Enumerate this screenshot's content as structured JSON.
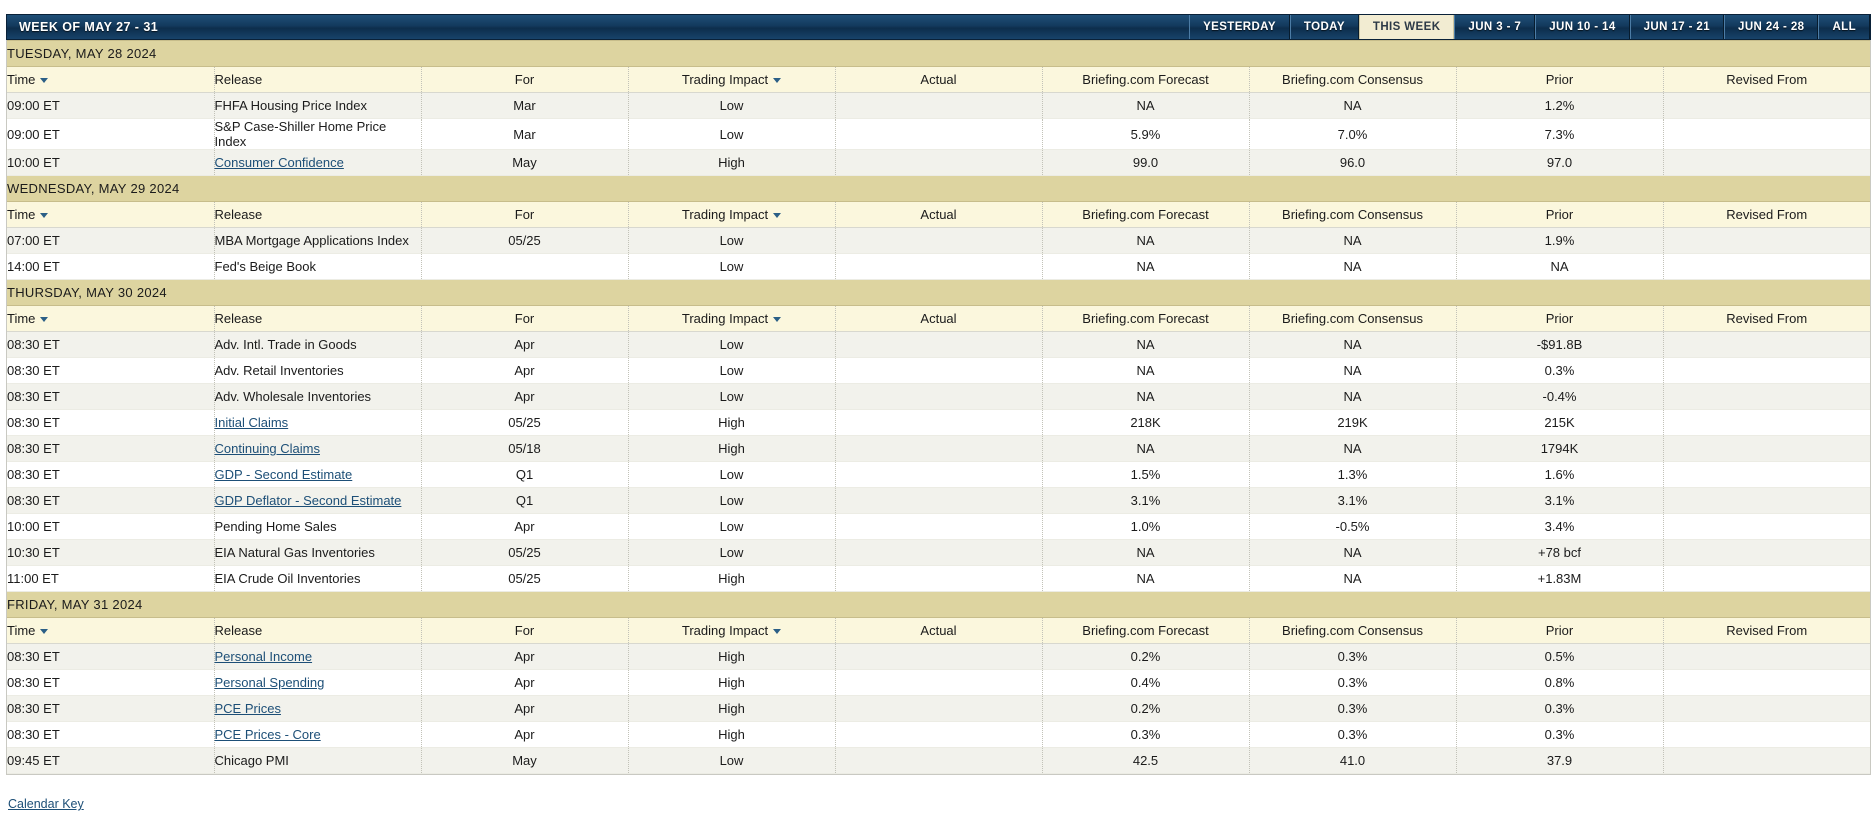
{
  "header": {
    "title": "WEEK OF MAY 27 - 31",
    "nav": [
      {
        "label": "YESTERDAY",
        "active": false
      },
      {
        "label": "TODAY",
        "active": false
      },
      {
        "label": "THIS WEEK",
        "active": true
      },
      {
        "label": "JUN 3 - 7",
        "active": false
      },
      {
        "label": "JUN 10 - 14",
        "active": false
      },
      {
        "label": "JUN 17 - 21",
        "active": false
      },
      {
        "label": "JUN 24 - 28",
        "active": false
      },
      {
        "label": "ALL",
        "active": false
      }
    ]
  },
  "columns": {
    "time": "Time",
    "release": "Release",
    "for": "For",
    "impact": "Trading Impact",
    "actual": "Actual",
    "forecast": "Briefing.com Forecast",
    "consensus": "Briefing.com Consensus",
    "prior": "Prior",
    "revised": "Revised From"
  },
  "icons": {
    "sort_caret": "caret-down-icon"
  },
  "days": [
    {
      "label": "TUESDAY, MAY 28 2024",
      "rows": [
        {
          "time": "09:00 ET",
          "release": "FHFA Housing Price Index",
          "link": false,
          "for": "Mar",
          "impact": "Low",
          "actual": "",
          "forecast": "NA",
          "consensus": "NA",
          "prior": "1.2%",
          "revised": ""
        },
        {
          "time": "09:00 ET",
          "release": "S&P Case-Shiller Home Price Index",
          "link": false,
          "for": "Mar",
          "impact": "Low",
          "actual": "",
          "forecast": "5.9%",
          "consensus": "7.0%",
          "prior": "7.3%",
          "revised": ""
        },
        {
          "time": "10:00 ET",
          "release": "Consumer Confidence",
          "link": true,
          "for": "May",
          "impact": "High",
          "actual": "",
          "forecast": "99.0",
          "consensus": "96.0",
          "prior": "97.0",
          "revised": ""
        }
      ]
    },
    {
      "label": "WEDNESDAY, MAY 29 2024",
      "rows": [
        {
          "time": "07:00 ET",
          "release": "MBA Mortgage Applications Index",
          "link": false,
          "for": "05/25",
          "impact": "Low",
          "actual": "",
          "forecast": "NA",
          "consensus": "NA",
          "prior": "1.9%",
          "revised": ""
        },
        {
          "time": "14:00 ET",
          "release": "Fed's Beige Book",
          "link": false,
          "for": "",
          "impact": "Low",
          "actual": "",
          "forecast": "NA",
          "consensus": "NA",
          "prior": "NA",
          "revised": ""
        }
      ]
    },
    {
      "label": "THURSDAY, MAY 30 2024",
      "rows": [
        {
          "time": "08:30 ET",
          "release": "Adv. Intl. Trade in Goods",
          "link": false,
          "for": "Apr",
          "impact": "Low",
          "actual": "",
          "forecast": "NA",
          "consensus": "NA",
          "prior": "-$91.8B",
          "revised": ""
        },
        {
          "time": "08:30 ET",
          "release": "Adv. Retail Inventories",
          "link": false,
          "for": "Apr",
          "impact": "Low",
          "actual": "",
          "forecast": "NA",
          "consensus": "NA",
          "prior": "0.3%",
          "revised": ""
        },
        {
          "time": "08:30 ET",
          "release": "Adv. Wholesale Inventories",
          "link": false,
          "for": "Apr",
          "impact": "Low",
          "actual": "",
          "forecast": "NA",
          "consensus": "NA",
          "prior": "-0.4%",
          "revised": ""
        },
        {
          "time": "08:30 ET",
          "release": "Initial Claims",
          "link": true,
          "for": "05/25",
          "impact": "High",
          "actual": "",
          "forecast": "218K",
          "consensus": "219K",
          "prior": "215K",
          "revised": ""
        },
        {
          "time": "08:30 ET",
          "release": "Continuing Claims",
          "link": true,
          "for": "05/18",
          "impact": "High",
          "actual": "",
          "forecast": "NA",
          "consensus": "NA",
          "prior": "1794K",
          "revised": ""
        },
        {
          "time": "08:30 ET",
          "release": "GDP - Second Estimate",
          "link": true,
          "for": "Q1",
          "impact": "Low",
          "actual": "",
          "forecast": "1.5%",
          "consensus": "1.3%",
          "prior": "1.6%",
          "revised": ""
        },
        {
          "time": "08:30 ET",
          "release": "GDP Deflator - Second Estimate",
          "link": true,
          "for": "Q1",
          "impact": "Low",
          "actual": "",
          "forecast": "3.1%",
          "consensus": "3.1%",
          "prior": "3.1%",
          "revised": ""
        },
        {
          "time": "10:00 ET",
          "release": "Pending Home Sales",
          "link": false,
          "for": "Apr",
          "impact": "Low",
          "actual": "",
          "forecast": "1.0%",
          "consensus": "-0.5%",
          "prior": "3.4%",
          "revised": ""
        },
        {
          "time": "10:30 ET",
          "release": "EIA Natural Gas Inventories",
          "link": false,
          "for": "05/25",
          "impact": "Low",
          "actual": "",
          "forecast": "NA",
          "consensus": "NA",
          "prior": "+78 bcf",
          "revised": ""
        },
        {
          "time": "11:00 ET",
          "release": "EIA Crude Oil Inventories",
          "link": false,
          "for": "05/25",
          "impact": "High",
          "actual": "",
          "forecast": "NA",
          "consensus": "NA",
          "prior": "+1.83M",
          "revised": ""
        }
      ]
    },
    {
      "label": "FRIDAY, MAY 31 2024",
      "rows": [
        {
          "time": "08:30 ET",
          "release": "Personal Income",
          "link": true,
          "for": "Apr",
          "impact": "High",
          "actual": "",
          "forecast": "0.2%",
          "consensus": "0.3%",
          "prior": "0.5%",
          "revised": ""
        },
        {
          "time": "08:30 ET",
          "release": "Personal Spending",
          "link": true,
          "for": "Apr",
          "impact": "High",
          "actual": "",
          "forecast": "0.4%",
          "consensus": "0.3%",
          "prior": "0.8%",
          "revised": ""
        },
        {
          "time": "08:30 ET",
          "release": "PCE Prices",
          "link": true,
          "for": "Apr",
          "impact": "High",
          "actual": "",
          "forecast": "0.2%",
          "consensus": "0.3%",
          "prior": "0.3%",
          "revised": ""
        },
        {
          "time": "08:30 ET",
          "release": "PCE Prices - Core",
          "link": true,
          "for": "Apr",
          "impact": "High",
          "actual": "",
          "forecast": "0.3%",
          "consensus": "0.3%",
          "prior": "0.3%",
          "revised": ""
        },
        {
          "time": "09:45 ET",
          "release": "Chicago PMI",
          "link": false,
          "for": "May",
          "impact": "Low",
          "actual": "",
          "forecast": "42.5",
          "consensus": "41.0",
          "prior": "37.9",
          "revised": ""
        }
      ]
    }
  ],
  "footer": {
    "calendar_key": "Calendar Key"
  }
}
